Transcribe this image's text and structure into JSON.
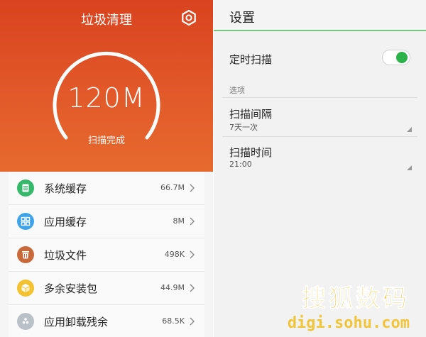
{
  "cleaner": {
    "title": "垃圾清理",
    "size_value": "120M",
    "status": "扫描完成",
    "items": [
      {
        "label": "系统缓存",
        "size": "66.7M",
        "color": "#34b86a",
        "icon": "document-icon"
      },
      {
        "label": "应用缓存",
        "size": "8M",
        "color": "#3fa3e8",
        "icon": "apps-grid-icon"
      },
      {
        "label": "垃圾文件",
        "size": "498K",
        "color": "#c8693c",
        "icon": "trash-icon"
      },
      {
        "label": "多余安装包",
        "size": "44.9M",
        "color": "#f3c230",
        "icon": "package-icon"
      },
      {
        "label": "应用卸载残余",
        "size": "68.5K",
        "color": "#b9c0c8",
        "icon": "residue-icon"
      }
    ]
  },
  "settings": {
    "title": "设置",
    "timer_label": "定时扫描",
    "timer_enabled": true,
    "section": "选项",
    "interval_title": "扫描间隔",
    "interval_value": "7天一次",
    "time_title": "扫描时间",
    "time_value": "21:00"
  },
  "watermark": {
    "line1": "搜狐数码",
    "line2": "digi.sohu.com"
  },
  "colors": {
    "accent_orange": "#e2592a",
    "toggle_green": "#2bb34a",
    "watermark": "#f0c53a"
  }
}
